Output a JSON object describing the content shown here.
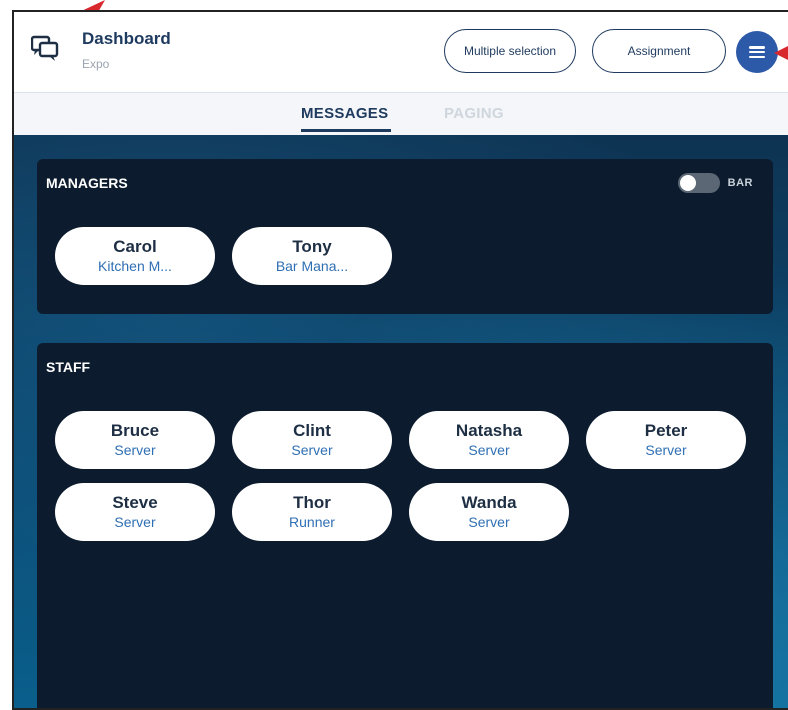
{
  "header": {
    "title": "Dashboard",
    "subtitle": "Expo",
    "multi_label": "Multiple selection",
    "assign_label": "Assignment"
  },
  "tabs": [
    {
      "label": "MESSAGES",
      "active": true
    },
    {
      "label": "PAGING",
      "active": false
    }
  ],
  "managers": {
    "title": "MANAGERS",
    "toggle_label": "BAR",
    "toggle_on": false,
    "people": [
      {
        "name": "Carol",
        "role": "Kitchen M..."
      },
      {
        "name": "Tony",
        "role": "Bar Mana..."
      }
    ]
  },
  "staff": {
    "title": "STAFF",
    "people": [
      {
        "name": "Bruce",
        "role": "Server"
      },
      {
        "name": "Clint",
        "role": "Server"
      },
      {
        "name": "Natasha",
        "role": "Server"
      },
      {
        "name": "Peter",
        "role": "Server"
      },
      {
        "name": "Steve",
        "role": "Server"
      },
      {
        "name": "Thor",
        "role": "Runner"
      },
      {
        "name": "Wanda",
        "role": "Server"
      }
    ]
  },
  "colors": {
    "brand": "#1e3a5f",
    "accent": "#2d5aa8",
    "role_text": "#2f6fb4",
    "annotation_arrow": "#d9272e"
  },
  "icons": [
    "chat-bubbles-logo-icon",
    "hamburger-menu-icon",
    "annotation-arrow-icon"
  ]
}
